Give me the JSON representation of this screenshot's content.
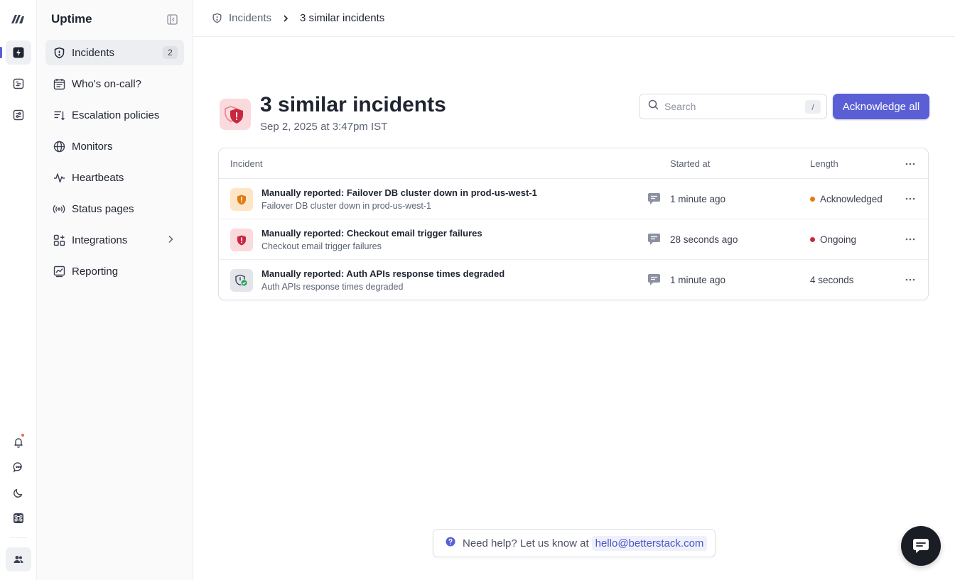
{
  "sidebar": {
    "app_title": "Uptime",
    "items": [
      {
        "label": "Incidents",
        "badge": "2",
        "icon": "shield-alert-icon"
      },
      {
        "label": "Who's on-call?",
        "icon": "calendar-icon"
      },
      {
        "label": "Escalation policies",
        "icon": "list-sort-icon"
      },
      {
        "label": "Monitors",
        "icon": "globe-icon"
      },
      {
        "label": "Heartbeats",
        "icon": "pulse-icon"
      },
      {
        "label": "Status pages",
        "icon": "broadcast-icon"
      },
      {
        "label": "Integrations",
        "icon": "puzzle-icon"
      },
      {
        "label": "Reporting",
        "icon": "chart-icon"
      }
    ]
  },
  "breadcrumb": {
    "parent": "Incidents",
    "current": "3 similar incidents"
  },
  "page": {
    "title": "3 similar incidents",
    "subtitle": "Sep 2, 2025 at 3:47pm IST"
  },
  "search": {
    "placeholder": "Search",
    "shortcut": "/"
  },
  "actions": {
    "acknowledge_all": "Acknowledge all"
  },
  "table": {
    "headers": {
      "incident": "Incident",
      "started_at": "Started at",
      "length": "Length"
    },
    "rows": [
      {
        "title": "Manually reported: Failover DB cluster down in prod-us-west-1",
        "subtitle": "Failover DB cluster down in prod-us-west-1",
        "started": "1 minute ago",
        "length": "Acknowledged",
        "status": "acknowledged"
      },
      {
        "title": "Manually reported: Checkout email trigger failures",
        "subtitle": "Checkout email trigger failures",
        "started": "28 seconds ago",
        "length": "Ongoing",
        "status": "ongoing"
      },
      {
        "title": "Manually reported: Auth APIs response times degraded",
        "subtitle": "Auth APIs response times degraded",
        "started": "1 minute ago",
        "length": "4 seconds",
        "status": "resolved"
      }
    ]
  },
  "help": {
    "text": "Need help? Let us know at",
    "email": "hello@betterstack.com"
  },
  "colors": {
    "accent": "#5a5fd6",
    "acknowledged": "#e07a12",
    "ongoing": "#c8283f",
    "resolved": "#22a05a"
  }
}
